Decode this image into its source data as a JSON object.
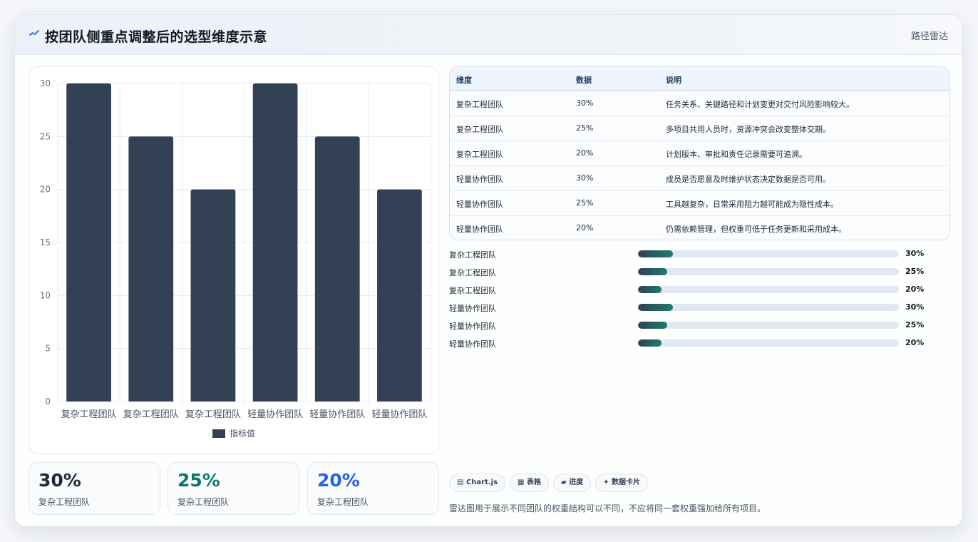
{
  "header": {
    "title": "按团队侧重点调整后的选型维度示意",
    "tag": "路径雷达",
    "accent": "#2563eb"
  },
  "chart_data": {
    "type": "bar",
    "categories": [
      "复杂工程团队",
      "复杂工程团队",
      "复杂工程团队",
      "轻量协作团队",
      "轻量协作团队",
      "轻量协作团队"
    ],
    "series": [
      {
        "name": "指标值",
        "values": [
          30,
          25,
          20,
          30,
          25,
          20
        ],
        "color": "#334155"
      }
    ],
    "ylim": [
      0,
      30
    ],
    "yticks": [
      0,
      5,
      10,
      15,
      20,
      25,
      30
    ],
    "grid": true,
    "legend": "bottom"
  },
  "stats": [
    {
      "value": "30%",
      "label": "复杂工程团队",
      "color": "#1f2937"
    },
    {
      "value": "25%",
      "label": "复杂工程团队",
      "color": "#0f766e"
    },
    {
      "value": "20%",
      "label": "复杂工程团队",
      "color": "#2563eb"
    }
  ],
  "table": {
    "headers": [
      "维度",
      "数据",
      "说明"
    ],
    "rows": [
      [
        "复杂工程团队",
        "30%",
        "任务关系、关键路径和计划变更对交付风险影响较大。"
      ],
      [
        "复杂工程团队",
        "25%",
        "多项目共用人员时，资源冲突会改变整体交期。"
      ],
      [
        "复杂工程团队",
        "20%",
        "计划版本、审批和责任记录需要可追溯。"
      ],
      [
        "轻量协作团队",
        "30%",
        "成员是否愿意及时维护状态决定数据是否可用。"
      ],
      [
        "轻量协作团队",
        "25%",
        "工具越复杂，日常采用阻力越可能成为隐性成本。"
      ],
      [
        "轻量协作团队",
        "20%",
        "仍需依赖管理，但权重可低于任务更新和采用成本。"
      ]
    ]
  },
  "progress": [
    {
      "label": "复杂工程团队",
      "pct": "30%",
      "value": 0.135
    },
    {
      "label": "复杂工程团队",
      "pct": "25%",
      "value": 0.112
    },
    {
      "label": "复杂工程团队",
      "pct": "20%",
      "value": 0.09
    },
    {
      "label": "轻量协作团队",
      "pct": "30%",
      "value": 0.135
    },
    {
      "label": "轻量协作团队",
      "pct": "25%",
      "value": 0.112
    },
    {
      "label": "轻量协作团队",
      "pct": "20%",
      "value": 0.09
    }
  ],
  "pills": [
    {
      "icon": "chart-icon",
      "glyph": "▤",
      "label": "Chart.js"
    },
    {
      "icon": "table-icon",
      "glyph": "▦",
      "label": "表格"
    },
    {
      "icon": "progress-icon",
      "glyph": "▰",
      "label": "进度"
    },
    {
      "icon": "card-icon",
      "glyph": "✦",
      "label": "数据卡片"
    }
  ],
  "note": "雷达图用于展示不同团队的权重结构可以不同，不应将同一套权重强加给所有项目。"
}
